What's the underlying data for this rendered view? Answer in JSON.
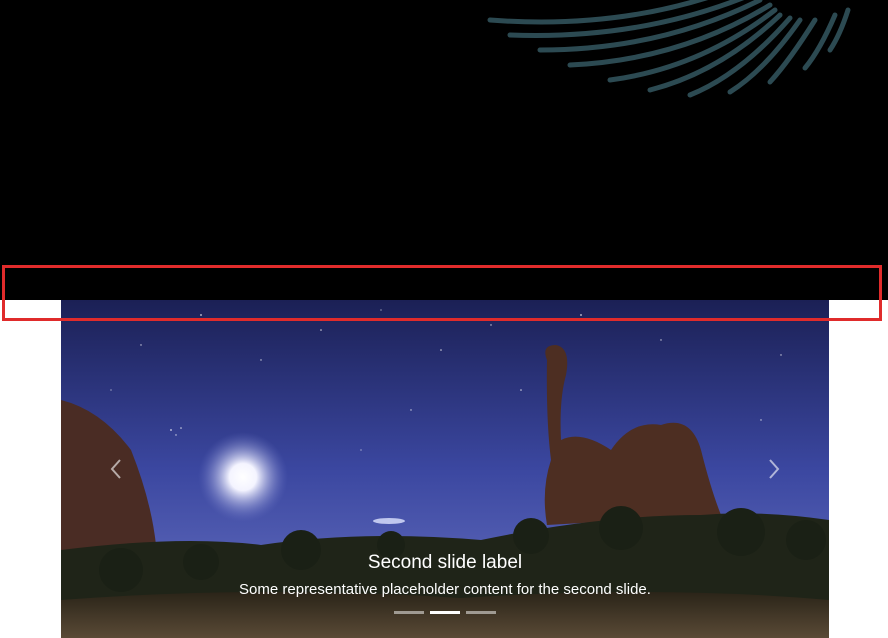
{
  "carousel": {
    "slide_label": "Second slide label",
    "slide_text": "Some representative placeholder content for the second slide.",
    "indicators": [
      {
        "active": false
      },
      {
        "active": true
      },
      {
        "active": false
      }
    ],
    "prev_icon": "chevron-left-icon",
    "next_icon": "chevron-right-icon"
  },
  "colors": {
    "hero_background": "#000000",
    "highlight_border": "#e02b2b",
    "leaf_tint": "#2c4a52",
    "caption_text": "#ffffff"
  }
}
